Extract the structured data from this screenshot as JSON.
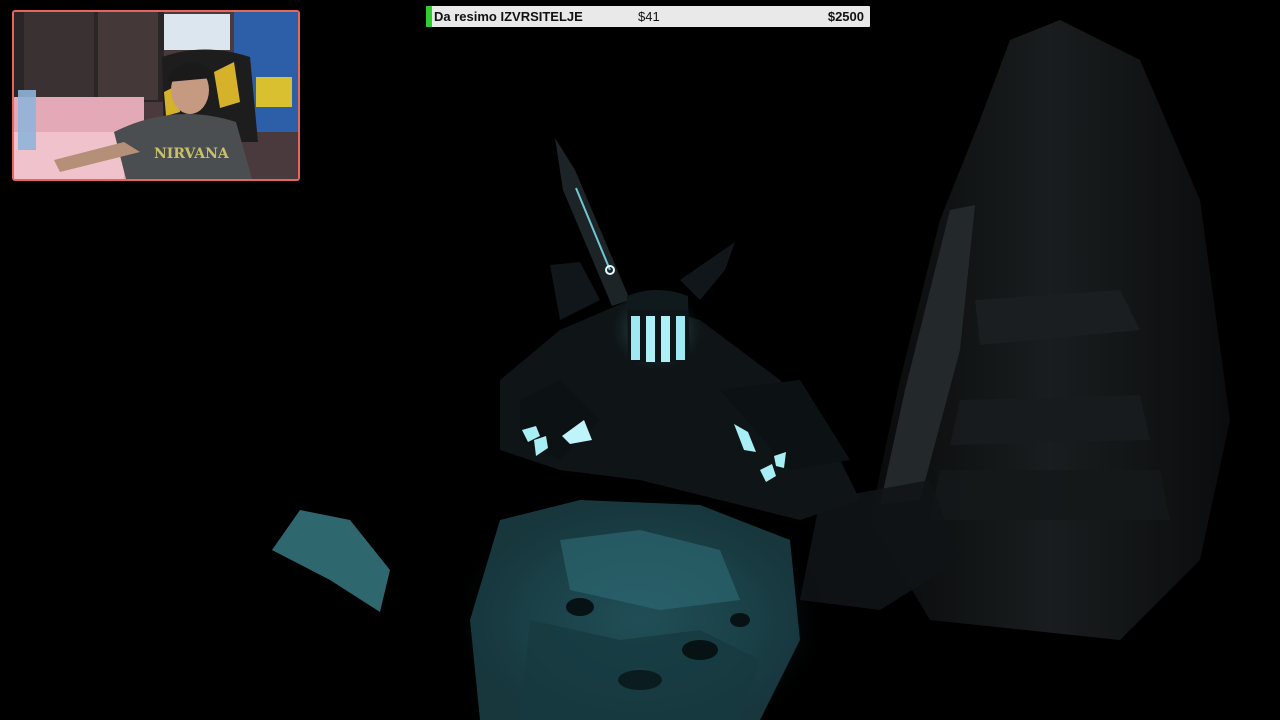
{
  "stream_overlay": {
    "goal": {
      "title": "Da resimo IZVRSITELJE",
      "current": "$41",
      "target": "$2500",
      "progress_fraction": 0.016,
      "fill_color": "#2ecc2e"
    },
    "webcam": {
      "border_color": "#e8655a",
      "shirt_text": "NIRVANA"
    }
  },
  "scene": {
    "glow_color": "#7fe3ee",
    "ambient": "dark cave"
  }
}
